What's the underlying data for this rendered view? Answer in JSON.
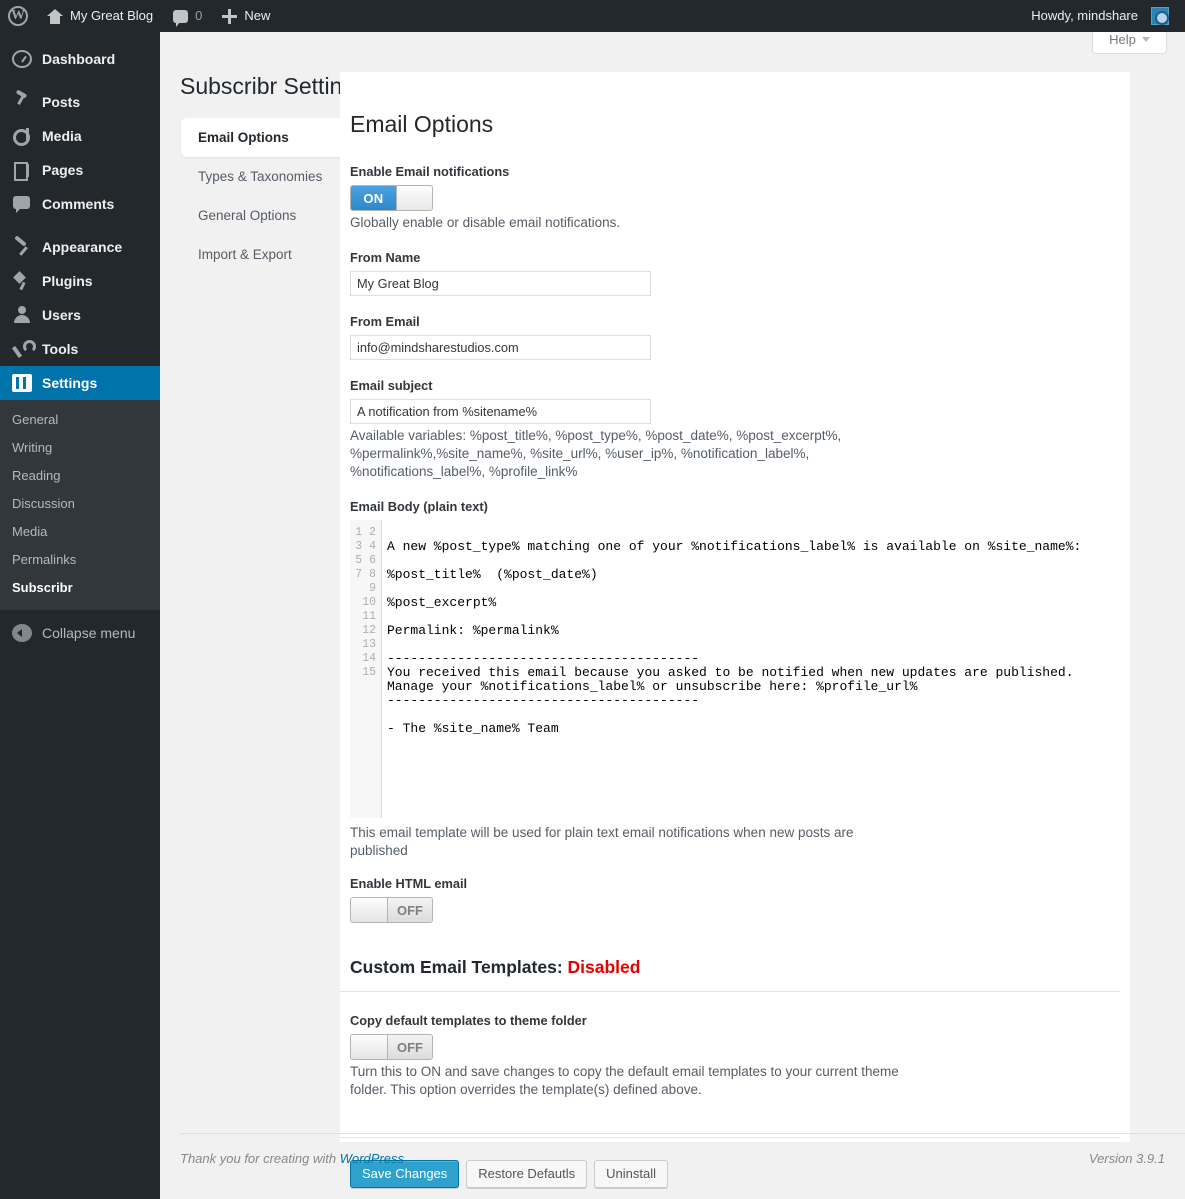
{
  "adminbar": {
    "logo_icon": "wordpress-logo-icon",
    "home_icon": "home-icon",
    "site_name": "My Great Blog",
    "comment_icon": "comment-bubble-icon",
    "comment_count": "0",
    "plus_icon": "plus-icon",
    "new_label": "New",
    "howdy": "Howdy, mindshare",
    "avatar": "user-avatar"
  },
  "sidebar": {
    "items": [
      {
        "label": "Dashboard",
        "icon": "dashboard-icon",
        "current": false
      },
      {
        "label": "Posts",
        "icon": "pin-icon",
        "current": false
      },
      {
        "label": "Media",
        "icon": "media-icon",
        "current": false
      },
      {
        "label": "Pages",
        "icon": "pages-icon",
        "current": false
      },
      {
        "label": "Comments",
        "icon": "comments-icon",
        "current": false
      },
      {
        "label": "Appearance",
        "icon": "paintbrush-icon",
        "current": false
      },
      {
        "label": "Plugins",
        "icon": "plug-icon",
        "current": false
      },
      {
        "label": "Users",
        "icon": "user-icon",
        "current": false
      },
      {
        "label": "Tools",
        "icon": "wrench-icon",
        "current": false
      },
      {
        "label": "Settings",
        "icon": "settings-icon",
        "current": true
      }
    ],
    "submenu": [
      {
        "label": "General",
        "current": false
      },
      {
        "label": "Writing",
        "current": false
      },
      {
        "label": "Reading",
        "current": false
      },
      {
        "label": "Discussion",
        "current": false
      },
      {
        "label": "Media",
        "current": false
      },
      {
        "label": "Permalinks",
        "current": false
      },
      {
        "label": "Subscribr",
        "current": true
      }
    ],
    "collapse_label": "Collapse menu",
    "collapse_icon": "collapse-arrow-icon"
  },
  "header": {
    "page_title": "Subscribr Settings",
    "help_label": "Help",
    "help_caret_icon": "chevron-down-icon"
  },
  "tabs": [
    {
      "label": "Email Options",
      "active": true
    },
    {
      "label": "Types & Taxonomies",
      "active": false
    },
    {
      "label": "General Options",
      "active": false
    },
    {
      "label": "Import & Export",
      "active": false
    }
  ],
  "main": {
    "section_title": "Email Options",
    "enable_email": {
      "label": "Enable Email notifications",
      "state": "ON",
      "off_text": "",
      "description": "Globally enable or disable email notifications."
    },
    "from_name": {
      "label": "From Name",
      "value": "My Great Blog"
    },
    "from_email": {
      "label": "From Email",
      "value": "info@mindsharestudios.com"
    },
    "email_subject": {
      "label": "Email subject",
      "value": "A notification from %sitename%",
      "description": "Available variables: %post_title%, %post_type%, %post_date%, %post_excerpt%, %permalink%,%site_name%, %site_url%, %user_ip%, %notification_label%, %notifications_label%, %profile_link%"
    },
    "email_body": {
      "label": "Email Body (plain text)",
      "line_numbers": "1\n2\n3\n4\n5\n6\n7\n8\n9\n10\n11\n12\n13\n14\n15",
      "code": "\nA new %post_type% matching one of your %notifications_label% is available on %site_name%:\n\n%post_title%  (%post_date%)\n\n%post_excerpt%\n\nPermalink: %permalink%\n\n----------------------------------------\nYou received this email because you asked to be notified when new updates are published.\nManage your %notifications_label% or unsubscribe here: %profile_url%\n----------------------------------------\n\n- The %site_name% Team",
      "description": "This email template will be used for plain text email notifications when new posts are published"
    },
    "enable_html": {
      "label": "Enable HTML email",
      "state": "OFF"
    },
    "custom_templates": {
      "heading": "Custom Email Templates:",
      "status": "Disabled",
      "status_color": "#e60000"
    },
    "copy_templates": {
      "label": "Copy default templates to theme folder",
      "state": "OFF",
      "description": "Turn this to ON and save changes to copy the default email templates to your current theme folder. This option overrides the template(s) defined above."
    },
    "buttons": {
      "save": "Save Changes",
      "restore": "Restore Defautls",
      "uninstall": "Uninstall"
    }
  },
  "footer": {
    "thanks_prefix": "Thank you for creating with ",
    "wordpress_link": "WordPress",
    "thanks_suffix": ".",
    "version": "Version 3.9.1"
  }
}
